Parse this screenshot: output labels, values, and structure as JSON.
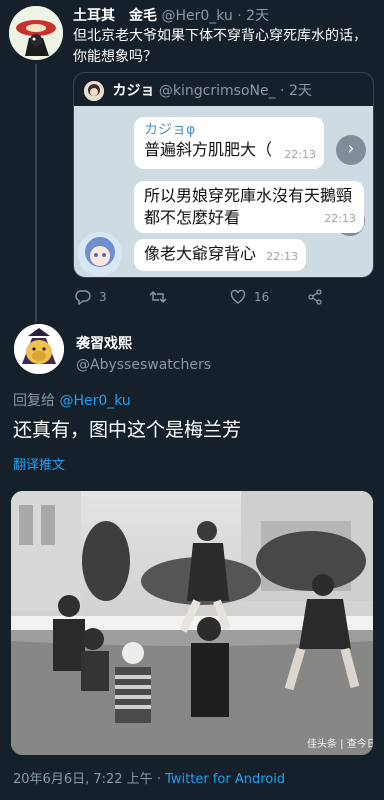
{
  "tweet1": {
    "display_name": "土耳其　金毛",
    "handle": "@Her0_ku",
    "dot": "·",
    "time": "2天",
    "text": "但北京老大爷如果下体不穿背心穿死库水的话，你能想象吗？",
    "quote": {
      "display_name": "カジョ",
      "handle": "@kingcrimsoNe_",
      "dot": "·",
      "time": "2天",
      "messages": [
        {
          "sender": "カジョφ",
          "text": "普遍斜方肌肥大（",
          "time": "22:13"
        },
        {
          "text": "所以男娘穿死庫水沒有天鵝頸都不怎麼好看",
          "time": "22:13"
        },
        {
          "text": "像老大爺穿背心",
          "time": "22:13"
        }
      ],
      "forward_icon": "share-forward-icon"
    },
    "actions": {
      "reply_count": "3",
      "retweet_count": "",
      "like_count": "16"
    }
  },
  "tweet2": {
    "display_name": "袭習戏熙",
    "handle": "@Abysseswatchers",
    "reply_prefix": "回复给",
    "reply_handle": "@Her0_ku",
    "text": "还真有，图中这个是梅兰芳",
    "translate_label": "翻译推文",
    "photo_watermark": "佳头条 | 查今日头",
    "timestamp": "20年6月6日, 7:22 上午",
    "sep": "·",
    "source": "Twitter for Android"
  },
  "colors": {
    "background": "#15202b",
    "accent": "#1da1f2",
    "muted": "#8899a6",
    "border": "#38444d"
  }
}
